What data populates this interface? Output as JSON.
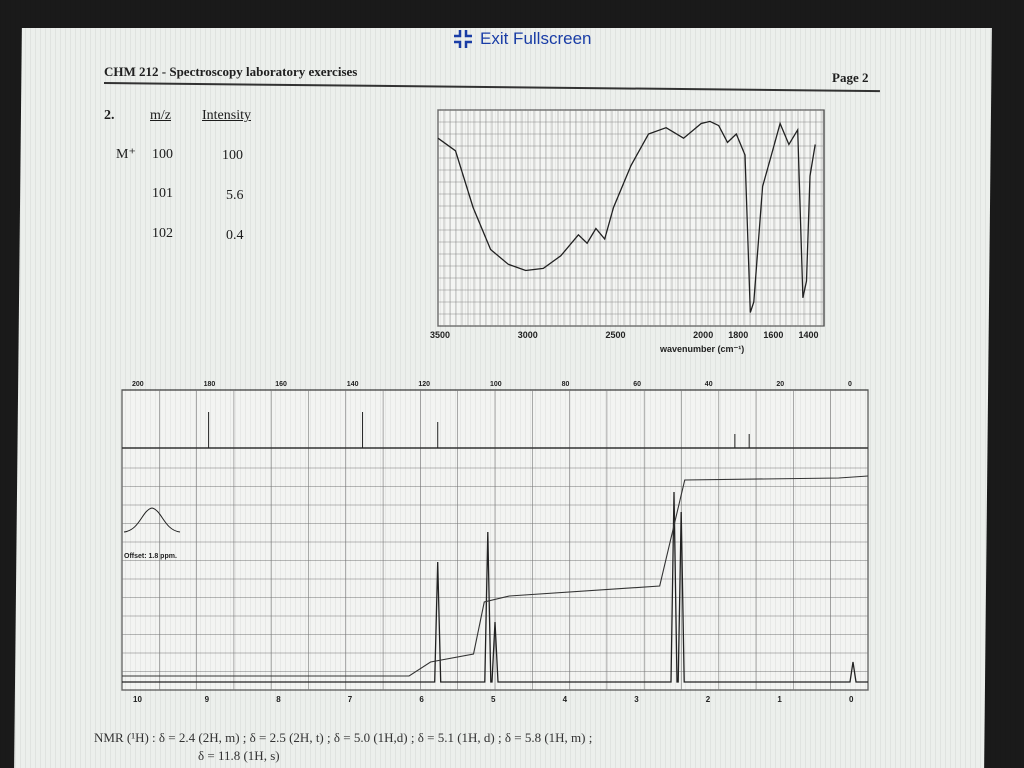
{
  "toolbar": {
    "exit_fullscreen_label": "Exit Fullscreen",
    "exit_fullscreen_icon": "compress-icon",
    "accent_color": "#1a3ea8"
  },
  "header": {
    "course": "CHM 212 - Spectroscopy laboratory exercises",
    "page": "Page 2"
  },
  "question": {
    "number": "2.",
    "ms_table": {
      "columns": [
        "m/z",
        "Intensity"
      ],
      "rows": [
        {
          "label": "M⁺",
          "mz": "100",
          "intensity": "100"
        },
        {
          "label": "",
          "mz": "101",
          "intensity": "5.6"
        },
        {
          "label": "",
          "mz": "102",
          "intensity": "0.4"
        }
      ]
    }
  },
  "chart_data": [
    {
      "type": "line",
      "chart": "IR spectrum",
      "xlabel": "wavenumber (cm⁻¹)",
      "x_ticks": [
        "3500",
        "3000",
        "2500",
        "2000",
        "1800",
        "1600",
        "1400"
      ],
      "xlim": [
        3500,
        1300
      ],
      "x": [
        3500,
        3400,
        3300,
        3200,
        3100,
        3000,
        2900,
        2800,
        2700,
        2650,
        2600,
        2550,
        2500,
        2400,
        2300,
        2200,
        2100,
        2000,
        1950,
        1900,
        1850,
        1800,
        1750,
        1720,
        1700,
        1650,
        1600,
        1550,
        1500,
        1450,
        1420,
        1400,
        1380,
        1350
      ],
      "y": [
        0.88,
        0.82,
        0.55,
        0.35,
        0.28,
        0.25,
        0.26,
        0.32,
        0.42,
        0.38,
        0.45,
        0.4,
        0.55,
        0.75,
        0.9,
        0.93,
        0.88,
        0.95,
        0.96,
        0.94,
        0.86,
        0.9,
        0.8,
        0.05,
        0.1,
        0.65,
        0.8,
        0.95,
        0.85,
        0.92,
        0.12,
        0.2,
        0.7,
        0.85
      ]
    },
    {
      "type": "line",
      "chart": "13C NMR spectrum",
      "x_ticks": [
        "200",
        "180",
        "160",
        "140",
        "120",
        "100",
        "80",
        "60",
        "40",
        "20",
        "0"
      ],
      "xlim": [
        200,
        0
      ],
      "peaks_ppm": [
        180,
        137,
        116,
        33,
        29
      ]
    },
    {
      "type": "line",
      "chart": "1H NMR spectrum",
      "x_ticks": [
        "10",
        "9",
        "8",
        "7",
        "6",
        "5",
        "4",
        "3",
        "2",
        "1",
        "0"
      ],
      "xlim": [
        10,
        0
      ],
      "offset_label": "Offset: 1.8 ppm.",
      "peaks_ppm": [
        5.8,
        5.1,
        5.0,
        2.5,
        2.4,
        0.0
      ]
    }
  ],
  "nmr_caption": {
    "line1": "NMR (¹H) : δ = 2.4 (2H, m) ; δ = 2.5 (2H, t) ; δ = 5.0 (1H,d) ; δ = 5.1 (1H, d) ; δ = 5.8 (1H, m) ;",
    "line2": "δ = 11.8 (1H, s)"
  }
}
